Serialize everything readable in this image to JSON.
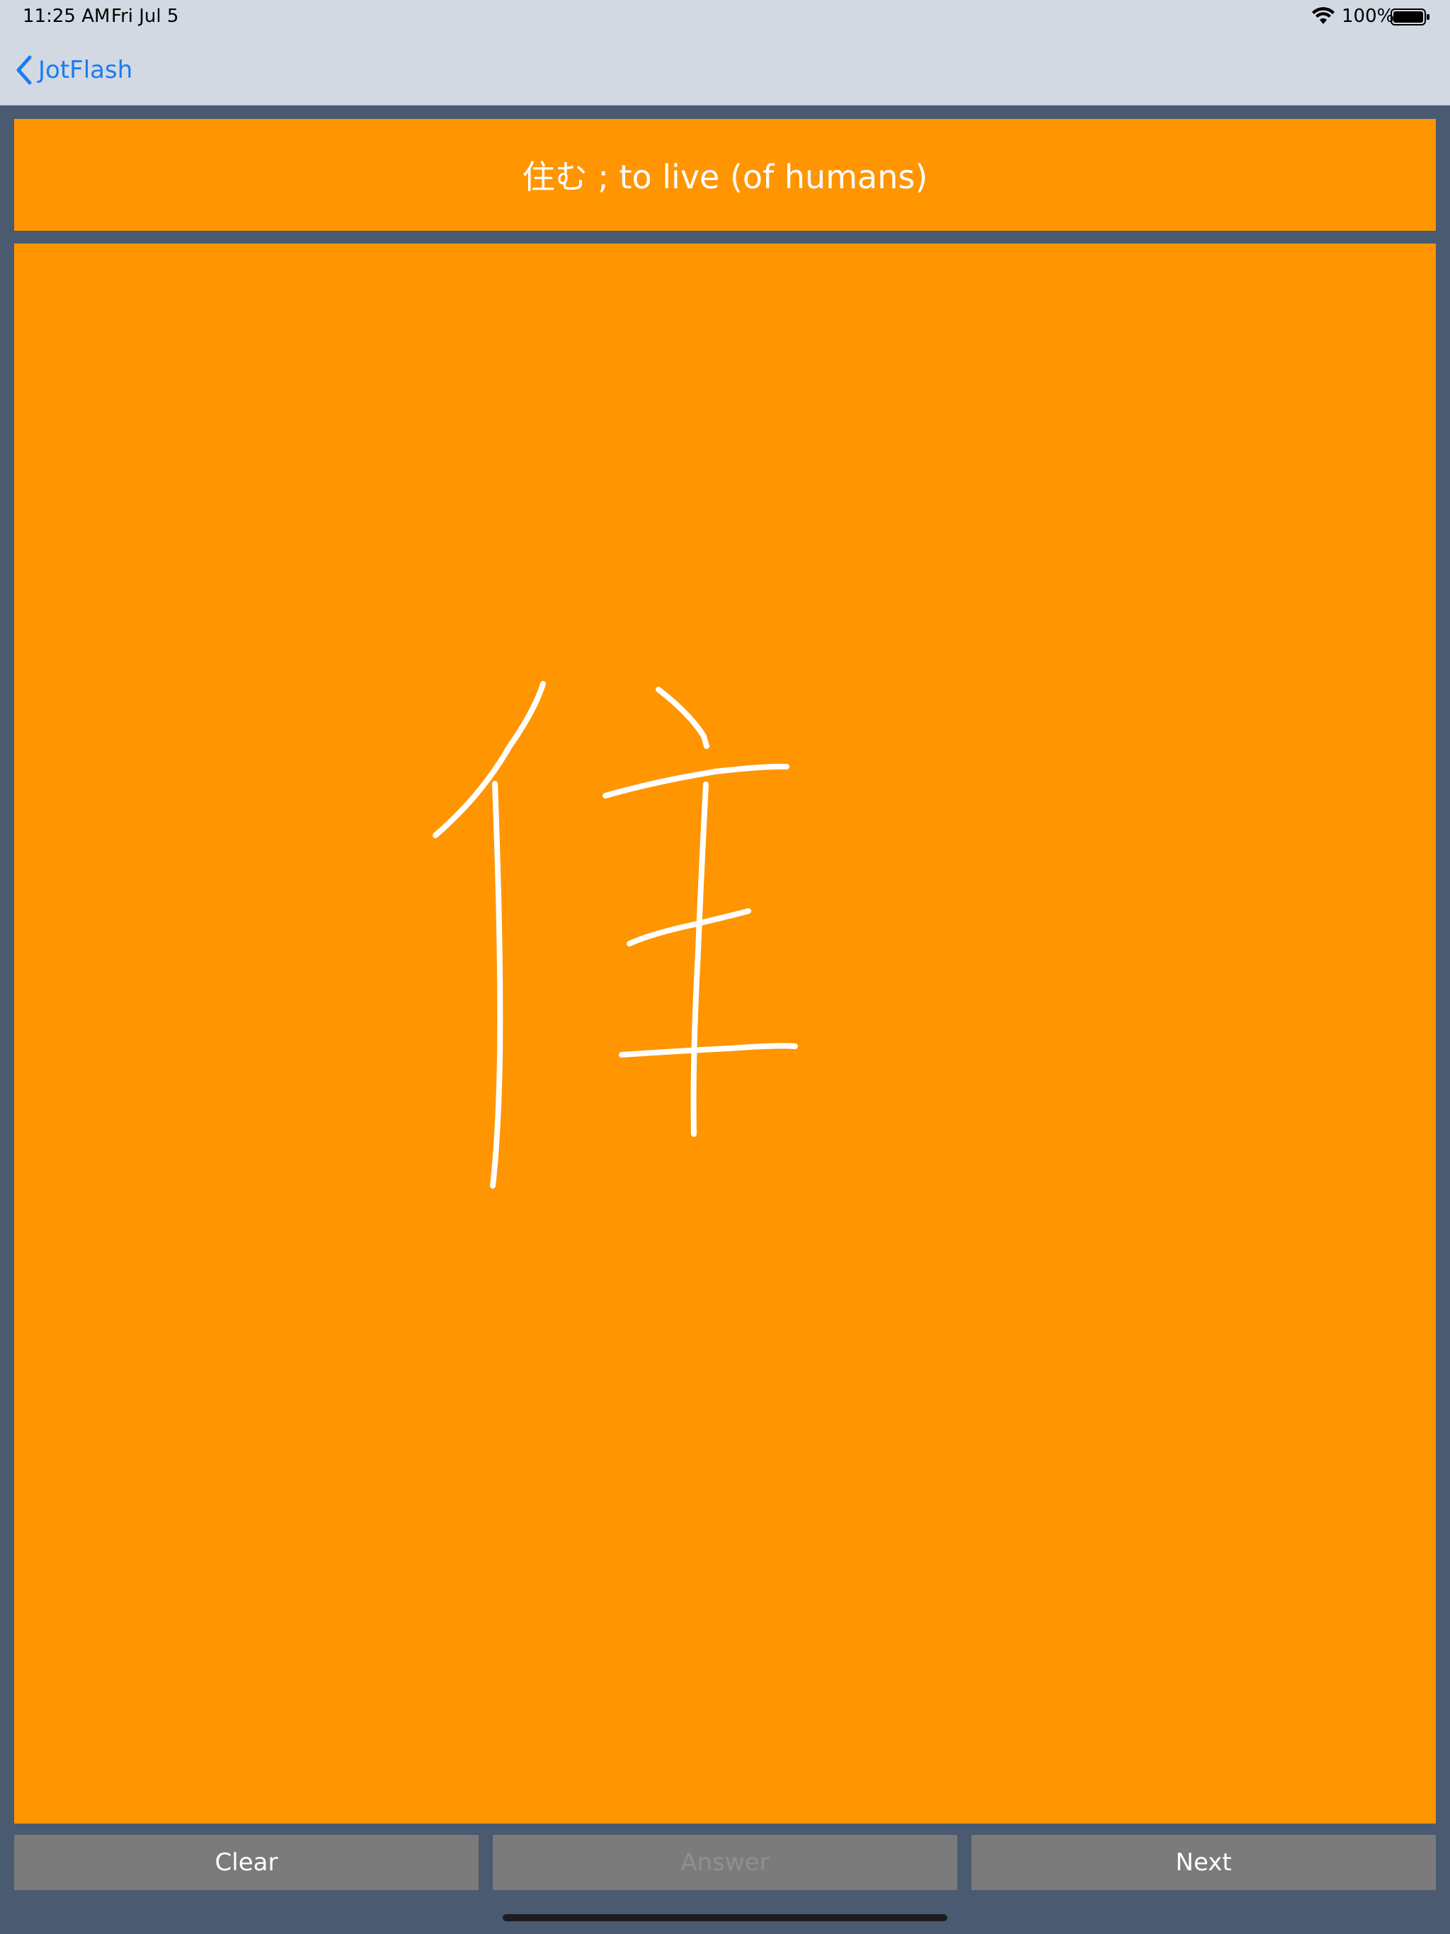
{
  "status_bar": {
    "time": "11:25 AM",
    "date": "Fri Jul 5",
    "battery_percent": "100%",
    "wifi_icon": "wifi-icon",
    "battery_icon": "battery-icon"
  },
  "nav": {
    "back_label": "JotFlash",
    "back_icon": "chevron-left-icon"
  },
  "card": {
    "prompt": "住む ; to live (of humans)"
  },
  "drawing": {
    "stroke_color": "#ffffff",
    "background_color": "#ff9500"
  },
  "buttons": {
    "clear": "Clear",
    "answer": "Answer",
    "next": "Next"
  },
  "colors": {
    "accent": "#ff9500",
    "link": "#1a7cf3",
    "button_bg": "#7b7b7b",
    "app_bg": "#4a5a70"
  }
}
